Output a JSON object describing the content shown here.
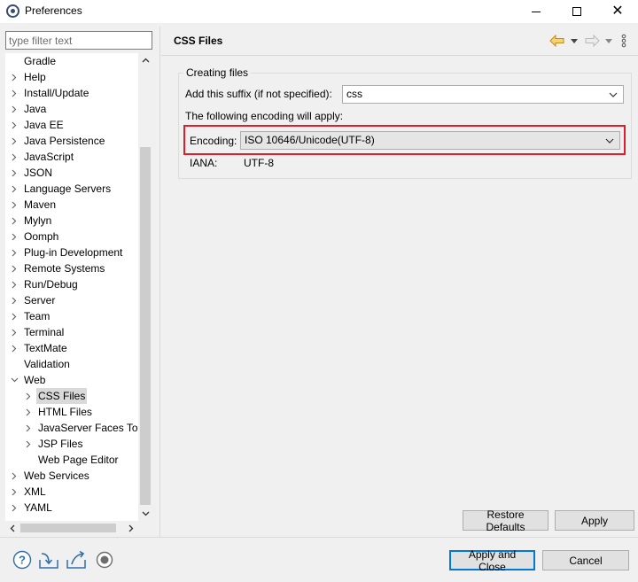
{
  "window": {
    "title": "Preferences"
  },
  "filter": {
    "placeholder": "type filter text",
    "value": ""
  },
  "tree": [
    {
      "label": "Gradle",
      "expander": "none",
      "level": 0
    },
    {
      "label": "Help",
      "expander": "collapsed",
      "level": 0
    },
    {
      "label": "Install/Update",
      "expander": "collapsed",
      "level": 0
    },
    {
      "label": "Java",
      "expander": "collapsed",
      "level": 0
    },
    {
      "label": "Java EE",
      "expander": "collapsed",
      "level": 0
    },
    {
      "label": "Java Persistence",
      "expander": "collapsed",
      "level": 0
    },
    {
      "label": "JavaScript",
      "expander": "collapsed",
      "level": 0
    },
    {
      "label": "JSON",
      "expander": "collapsed",
      "level": 0
    },
    {
      "label": "Language Servers",
      "expander": "collapsed",
      "level": 0
    },
    {
      "label": "Maven",
      "expander": "collapsed",
      "level": 0
    },
    {
      "label": "Mylyn",
      "expander": "collapsed",
      "level": 0
    },
    {
      "label": "Oomph",
      "expander": "collapsed",
      "level": 0
    },
    {
      "label": "Plug-in Development",
      "expander": "collapsed",
      "level": 0
    },
    {
      "label": "Remote Systems",
      "expander": "collapsed",
      "level": 0
    },
    {
      "label": "Run/Debug",
      "expander": "collapsed",
      "level": 0
    },
    {
      "label": "Server",
      "expander": "collapsed",
      "level": 0
    },
    {
      "label": "Team",
      "expander": "collapsed",
      "level": 0
    },
    {
      "label": "Terminal",
      "expander": "collapsed",
      "level": 0
    },
    {
      "label": "TextMate",
      "expander": "collapsed",
      "level": 0
    },
    {
      "label": "Validation",
      "expander": "none",
      "level": 0
    },
    {
      "label": "Web",
      "expander": "expanded",
      "level": 0
    },
    {
      "label": "CSS Files",
      "expander": "collapsed",
      "level": 1,
      "selected": true
    },
    {
      "label": "HTML Files",
      "expander": "collapsed",
      "level": 1
    },
    {
      "label": "JavaServer Faces Tools",
      "expander": "collapsed",
      "level": 1
    },
    {
      "label": "JSP Files",
      "expander": "collapsed",
      "level": 1
    },
    {
      "label": "Web Page Editor",
      "expander": "none",
      "level": 1
    },
    {
      "label": "Web Services",
      "expander": "collapsed",
      "level": 0
    },
    {
      "label": "XML",
      "expander": "collapsed",
      "level": 0
    },
    {
      "label": "YAML",
      "expander": "collapsed",
      "level": 0
    }
  ],
  "page": {
    "title": "CSS Files",
    "group_label": "Creating files",
    "suffix_label": "Add this suffix (if not specified):",
    "suffix_value": "css",
    "encoding_intro": "The following encoding will apply:",
    "encoding_label": "Encoding:",
    "encoding_value": "ISO 10646/Unicode(UTF-8)",
    "iana_label": "IANA:",
    "iana_value": "UTF-8"
  },
  "buttons": {
    "restore_defaults": "Restore Defaults",
    "apply": "Apply",
    "apply_and_close": "Apply and Close",
    "cancel": "Cancel"
  },
  "icons": {
    "back": "back-arrow-icon",
    "forward": "forward-arrow-icon",
    "menu": "view-menu-icon",
    "help": "help-icon",
    "import": "import-icon",
    "export": "export-icon",
    "record": "record-icon"
  },
  "colors": {
    "highlight_border": "#e01e2b",
    "back_arrow": "#e8b43a",
    "default_button_border": "#0078d7",
    "icon_blue": "#2f6fa8"
  }
}
